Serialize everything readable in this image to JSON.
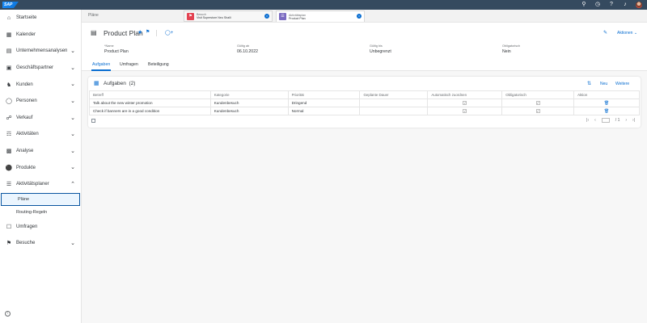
{
  "shellbar": {
    "logo": "SAP",
    "icons": [
      "search-icon",
      "history-icon",
      "help-icon",
      "notifications-icon"
    ]
  },
  "sidebar": {
    "items": [
      {
        "label": "Startseite",
        "icon": "home-icon",
        "chev": false
      },
      {
        "label": "Kalender",
        "icon": "calendar-icon",
        "chev": false
      },
      {
        "label": "Unternehmensanalysen",
        "icon": "analytics-icon",
        "chev": true
      },
      {
        "label": "Geschäftspartner",
        "icon": "partner-icon",
        "chev": true
      },
      {
        "label": "Kunden",
        "icon": "customer-icon",
        "chev": true
      },
      {
        "label": "Personen",
        "icon": "person-icon",
        "chev": true
      },
      {
        "label": "Verkauf",
        "icon": "sales-icon",
        "chev": true
      },
      {
        "label": "Aktivitäten",
        "icon": "activity-icon",
        "chev": true
      },
      {
        "label": "Analyse",
        "icon": "analysis-icon",
        "chev": true
      },
      {
        "label": "Produkte",
        "icon": "product-icon",
        "chev": true
      },
      {
        "label": "Aktivitätsplaner",
        "icon": "planner-icon",
        "chev": "up"
      }
    ],
    "sub": [
      {
        "label": "Pläne",
        "active": true
      },
      {
        "label": "Routing-Regeln",
        "active": false
      }
    ],
    "after": [
      {
        "label": "Umfragen",
        "icon": "survey-icon",
        "chev": false
      },
      {
        "label": "Besuche",
        "icon": "visit-icon",
        "chev": true
      }
    ]
  },
  "tabs": {
    "plain": "Pläne",
    "tab1": {
      "line1": "Besuch",
      "line2": "Visit Superstore Neu Shalli"
    },
    "tab2": {
      "line1": "Aktivitätsplan",
      "line2": "Product Plan"
    }
  },
  "header": {
    "title": "Product Plan",
    "actions": "Aktionen",
    "fields": [
      {
        "label": "*Name",
        "value": "Product Plan"
      },
      {
        "label": "Gültig ab",
        "value": "06.10.2022"
      },
      {
        "label": "Gültig bis",
        "value": "Unbegrenzt"
      },
      {
        "label": "Obligatorisch",
        "value": "Nein"
      }
    ]
  },
  "subtabs": [
    "Aufgaben",
    "Umfragen",
    "Beteiligung"
  ],
  "panel": {
    "title": "Aufgaben",
    "count": "(2)",
    "new": "Neu",
    "more": "Weitere",
    "columns": [
      "Betreff",
      "Kategorie",
      "Priorität",
      "Geplante Dauer",
      "Automatisch zuordnen",
      "Obligatorisch",
      "Aktion"
    ],
    "rows": [
      {
        "subject": "Talk about the new winter promotion",
        "category": "Kundenbesuch",
        "priority": "Dringend",
        "duration": ""
      },
      {
        "subject": "Check if banners are in a good condition",
        "category": "Kundenbesuch",
        "priority": "Normal",
        "duration": ""
      }
    ],
    "pager": "/ 1"
  }
}
